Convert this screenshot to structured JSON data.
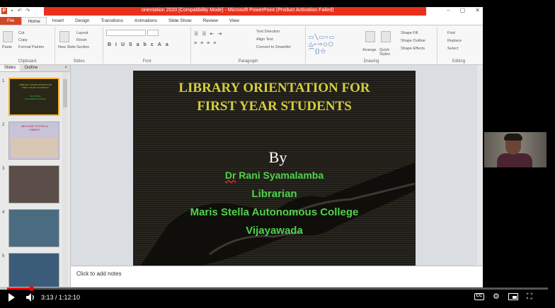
{
  "window": {
    "title": "orientation 2020 [Compatibility Mode] - Microsoft PowerPoint (Product Activation Failed)",
    "app_logo": "P"
  },
  "ribbon_tabs": [
    {
      "label": "File"
    },
    {
      "label": "Home"
    },
    {
      "label": "Insert"
    },
    {
      "label": "Design"
    },
    {
      "label": "Transitions"
    },
    {
      "label": "Animations"
    },
    {
      "label": "Slide Show"
    },
    {
      "label": "Review"
    },
    {
      "label": "View"
    }
  ],
  "ribbon": {
    "clipboard": {
      "label": "Clipboard",
      "paste": "Paste",
      "cut": "Cut",
      "copy": "Copy",
      "format_painter": "Format Painter"
    },
    "slides": {
      "label": "Slides",
      "new_slide": "New Slide",
      "layout": "Layout",
      "reset": "Reset",
      "section": "Section"
    },
    "font": {
      "label": "Font"
    },
    "paragraph": {
      "label": "Paragraph",
      "text_direction": "Text Direction",
      "align_text": "Align Text",
      "smartart": "Convert to SmartArt"
    },
    "drawing": {
      "label": "Drawing",
      "arrange": "Arrange",
      "quick_styles": "Quick Styles",
      "shape_fill": "Shape Fill",
      "shape_outline": "Shape Outline",
      "shape_effects": "Shape Effects"
    },
    "editing": {
      "label": "Editing",
      "find": "Find",
      "replace": "Replace",
      "select": "Select"
    }
  },
  "pane_tabs": {
    "slides": "Slides",
    "outline": "Outline",
    "close": "×"
  },
  "thumbnails": [
    {
      "num": "1",
      "title": "LIBRARY ORIENTATION FOR FIRST YEAR STUDENTS",
      "sub": "By Dr Rani Syamalamba Librarian"
    },
    {
      "num": "2",
      "title": "WELCOME TO STELLA LIBRARY"
    },
    {
      "num": "3"
    },
    {
      "num": "4"
    },
    {
      "num": "5"
    }
  ],
  "slide": {
    "title_line1": "LIBRARY ORIENTATION FOR",
    "title_line2": "FIRST YEAR STUDENTS",
    "by": "By",
    "dr": "Dr",
    "name": "Rani Syamalamba",
    "role": "Librarian",
    "college": "Maris Stella Autonomous  College",
    "city": "Vijayawada"
  },
  "notes_placeholder": "Click to add notes",
  "video": {
    "time": "3:13 / 1:12:10",
    "cc": "CC",
    "progress_fraction": 0.044
  },
  "colors": {
    "title_yellow": "#d4ce3e",
    "green": "#4ed34a",
    "ppt_orange": "#d24726",
    "yt_red": "#ff0000"
  }
}
